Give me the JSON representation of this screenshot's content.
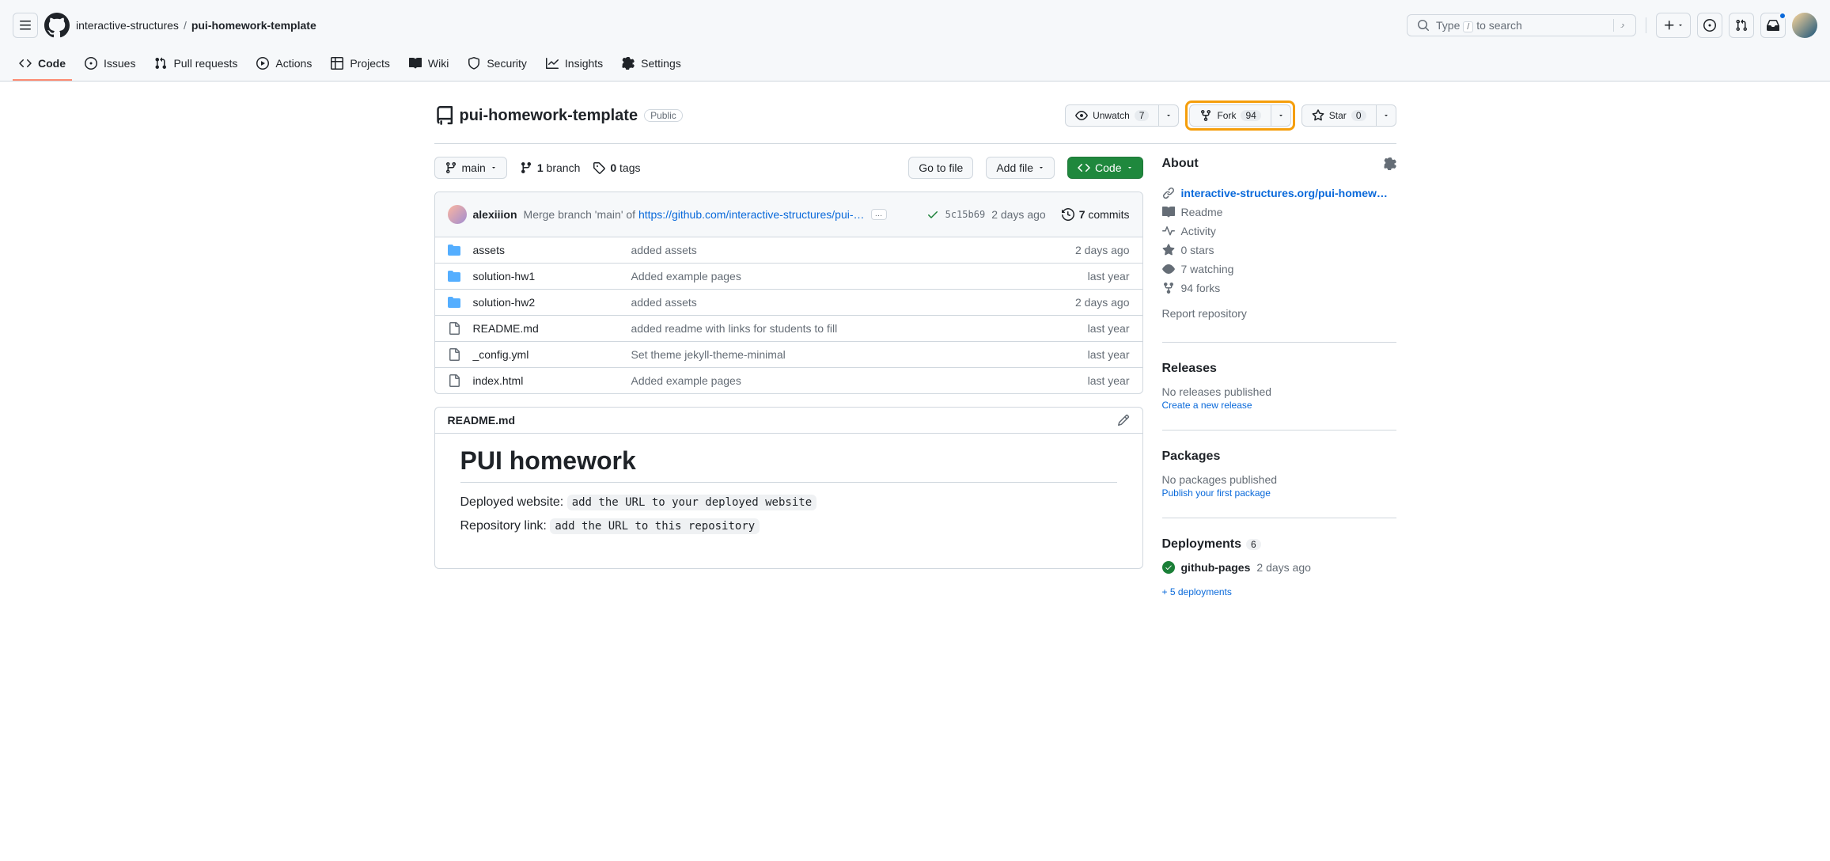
{
  "header": {
    "owner": "interactive-structures",
    "repo": "pui-homework-template",
    "search_placeholder": "Type / to search"
  },
  "tabs": [
    {
      "label": "Code"
    },
    {
      "label": "Issues"
    },
    {
      "label": "Pull requests"
    },
    {
      "label": "Actions"
    },
    {
      "label": "Projects"
    },
    {
      "label": "Wiki"
    },
    {
      "label": "Security"
    },
    {
      "label": "Insights"
    },
    {
      "label": "Settings"
    }
  ],
  "repo_head": {
    "name": "pui-homework-template",
    "visibility": "Public",
    "unwatch_label": "Unwatch",
    "unwatch_count": "7",
    "fork_label": "Fork",
    "fork_count": "94",
    "star_label": "Star",
    "star_count": "0"
  },
  "toolbar": {
    "branch": "main",
    "branches_count": "1",
    "branches_label": "branch",
    "tags_count": "0",
    "tags_label": "tags",
    "goto_file": "Go to file",
    "add_file": "Add file",
    "code": "Code"
  },
  "latest_commit": {
    "author": "alexiiion",
    "message_prefix": "Merge branch 'main' of ",
    "message_link": "https://github.com/interactive-structures/pui-…",
    "hash": "5c15b69",
    "time": "2 days ago",
    "commits_count": "7",
    "commits_label": "commits"
  },
  "files": [
    {
      "type": "dir",
      "name": "assets",
      "msg": "added assets",
      "time": "2 days ago"
    },
    {
      "type": "dir",
      "name": "solution-hw1",
      "msg": "Added example pages",
      "time": "last year"
    },
    {
      "type": "dir",
      "name": "solution-hw2",
      "msg": "added assets",
      "time": "2 days ago"
    },
    {
      "type": "file",
      "name": "README.md",
      "msg": "added readme with links for students to fill",
      "time": "last year"
    },
    {
      "type": "file",
      "name": "_config.yml",
      "msg": "Set theme jekyll-theme-minimal",
      "time": "last year"
    },
    {
      "type": "file",
      "name": "index.html",
      "msg": "Added example pages",
      "time": "last year"
    }
  ],
  "readme": {
    "filename": "README.md",
    "heading": "PUI homework",
    "deployed_label": "Deployed website: ",
    "deployed_code": "add the URL to your deployed website",
    "repo_label": "Repository link: ",
    "repo_code": "add the URL to this repository"
  },
  "about": {
    "title": "About",
    "url": "interactive-structures.org/pui-homew…",
    "readme": "Readme",
    "activity": "Activity",
    "stars": "0 stars",
    "watching": "7 watching",
    "forks": "94 forks",
    "report": "Report repository"
  },
  "releases": {
    "title": "Releases",
    "none": "No releases published",
    "create": "Create a new release"
  },
  "packages": {
    "title": "Packages",
    "none": "No packages published",
    "publish": "Publish your first package"
  },
  "deployments": {
    "title": "Deployments",
    "count": "6",
    "env": "github-pages",
    "time": "2 days ago",
    "more": "+ 5 deployments"
  }
}
